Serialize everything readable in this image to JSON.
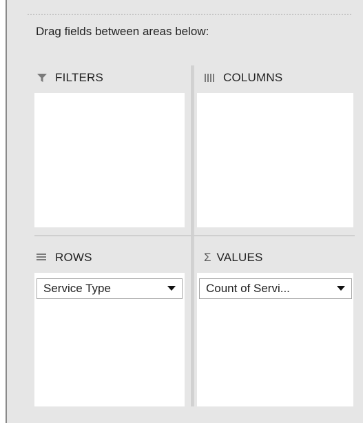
{
  "pivot_panel": {
    "instruction": "Drag fields between areas below:",
    "areas": {
      "filters": {
        "label": "FILTERS",
        "icon": "filter-icon",
        "fields": []
      },
      "columns": {
        "label": "COLUMNS",
        "icon": "columns-icon",
        "fields": []
      },
      "rows": {
        "label": "ROWS",
        "icon": "rows-icon",
        "fields": [
          "Service Type"
        ]
      },
      "values": {
        "label": "VALUES",
        "icon": "sigma-icon",
        "icon_glyph": "Σ",
        "fields": [
          "Count of Servi..."
        ]
      }
    }
  },
  "colors": {
    "panel_bg": "#e6e6e6",
    "drop_area_bg": "#ffffff",
    "icon_gray": "#7a7a7a",
    "text": "#222222"
  }
}
